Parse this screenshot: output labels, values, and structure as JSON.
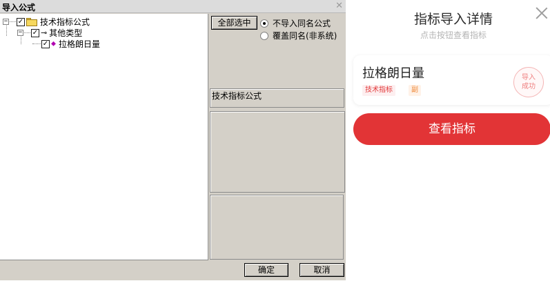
{
  "dialog": {
    "title": "导入公式",
    "close_glyph": "✕",
    "tree": {
      "root": {
        "label": "技术指标公式",
        "expander": "−",
        "checked": true
      },
      "child": {
        "label": "其他类型",
        "expander": "−",
        "checked": true
      },
      "leaf": {
        "label": "拉格朗日量",
        "checked": true
      }
    },
    "select_all_label": "全部选中",
    "radio_options": [
      {
        "label": "不导入同名公式",
        "selected": true
      },
      {
        "label": "覆盖同名(非系统)",
        "selected": false
      }
    ],
    "category_text": "技术指标公式",
    "ok_label": "确定",
    "cancel_label": "取消"
  },
  "sheet": {
    "title": "指标导入详情",
    "subtitle": "点击按钮查看指标",
    "card": {
      "name": "拉格朗日量",
      "tag_type": "技术指标",
      "tag_sub": "副",
      "stamp_line1": "导入",
      "stamp_line2": "成功"
    },
    "view_button_label": "查看指标",
    "colors": {
      "primary": "#e23436",
      "tag_text": "#e2393a",
      "sub_tag_text": "#ef8b3c"
    }
  }
}
